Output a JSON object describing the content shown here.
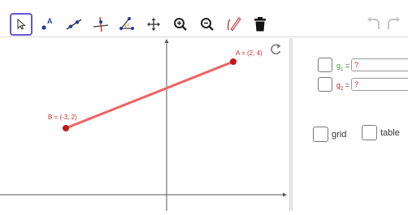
{
  "toolbar": {
    "tools": [
      {
        "name": "move-tool",
        "icon": "arrow-pointer-icon",
        "active": true
      },
      {
        "name": "point-tool",
        "icon": "point-icon",
        "letter": "A"
      },
      {
        "name": "line-tool",
        "icon": "line-icon"
      },
      {
        "name": "perpendicular-tool",
        "icon": "perpendicular-line-icon"
      },
      {
        "name": "angle-tool",
        "icon": "angle-icon",
        "letter": "α"
      },
      {
        "name": "move-graphics-tool",
        "icon": "move-arrows-icon"
      },
      {
        "name": "zoom-in-tool",
        "icon": "zoom-in-icon"
      },
      {
        "name": "zoom-out-tool",
        "icon": "zoom-out-icon"
      },
      {
        "name": "pen-tool",
        "icon": "pen-icon"
      },
      {
        "name": "delete-tool",
        "icon": "trash-icon"
      }
    ],
    "undo_icon": "undo-icon",
    "redo_icon": "redo-icon"
  },
  "graphics": {
    "point_a_label": "A = (2, 4)",
    "point_b_label": "B = (-3, 2)",
    "segment_color": "#f06262",
    "point_color": "#c4161c",
    "reset_icon": "refresh-icon"
  },
  "side_panel": {
    "g1_label": "g",
    "g1_sub": "1",
    "g1_eq": " =",
    "g1_value": "?",
    "g2_label": "g",
    "g2_sub": "2",
    "g2_eq": " =",
    "g2_value": "?",
    "grid_label": "grid",
    "table_label": "table",
    "g1_color": "#3c9a2f",
    "g2_color": "#c81d1d"
  }
}
